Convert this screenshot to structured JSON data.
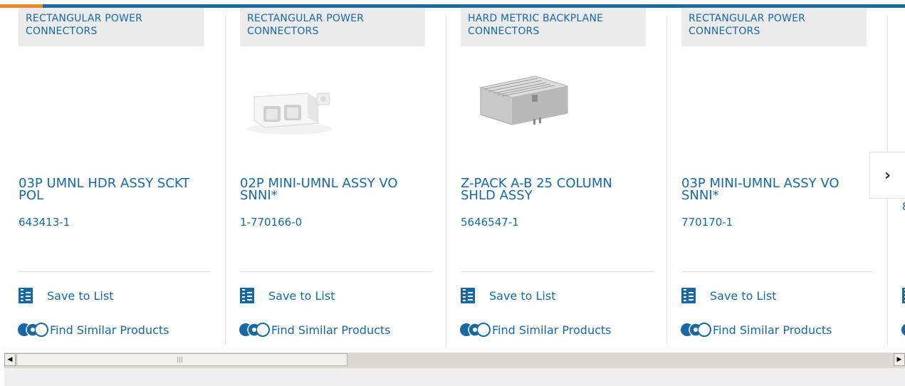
{
  "products": [
    {
      "category": "RECTANGULAR POWER CONNECTORS",
      "title": "03P UMNL HDR ASSY SCKT POL",
      "part_number": "643413-1",
      "save_label": "Save to List",
      "similar_label": "Find Similar Products",
      "image": "none"
    },
    {
      "category": "RECTANGULAR POWER CONNECTORS",
      "title": "02P MINI-UMNL ASSY VO SNNI*",
      "part_number": "1-770166-0",
      "save_label": "Save to List",
      "similar_label": "Find Similar Products",
      "image": "white-2-pin-connector"
    },
    {
      "category": "HARD METRIC BACKPLANE CONNECTORS",
      "title": "Z-PACK A-B 25 COLUMN SHLD ASSY",
      "part_number": "5646547-1",
      "save_label": "Save to List",
      "similar_label": "Find Similar Products",
      "image": "gray-backplane-connector"
    },
    {
      "category": "RECTANGULAR POWER CONNECTORS",
      "title": "03P MINI-UMNL ASSY VO SNNI*",
      "part_number": "770170-1",
      "save_label": "Save to List",
      "similar_label": "Find Similar Products",
      "image": "none"
    }
  ],
  "partial_card": {
    "part_number_fragment": "8"
  },
  "navigation": {
    "next_icon": "chevron-right-icon",
    "next_symbol": "›"
  },
  "scrollbar": {
    "left_arrow": "◀",
    "right_arrow": "▶"
  },
  "colors": {
    "brand_blue": "#1769a5",
    "accent_orange": "#e98a2d",
    "category_bg": "#ebebeb"
  }
}
